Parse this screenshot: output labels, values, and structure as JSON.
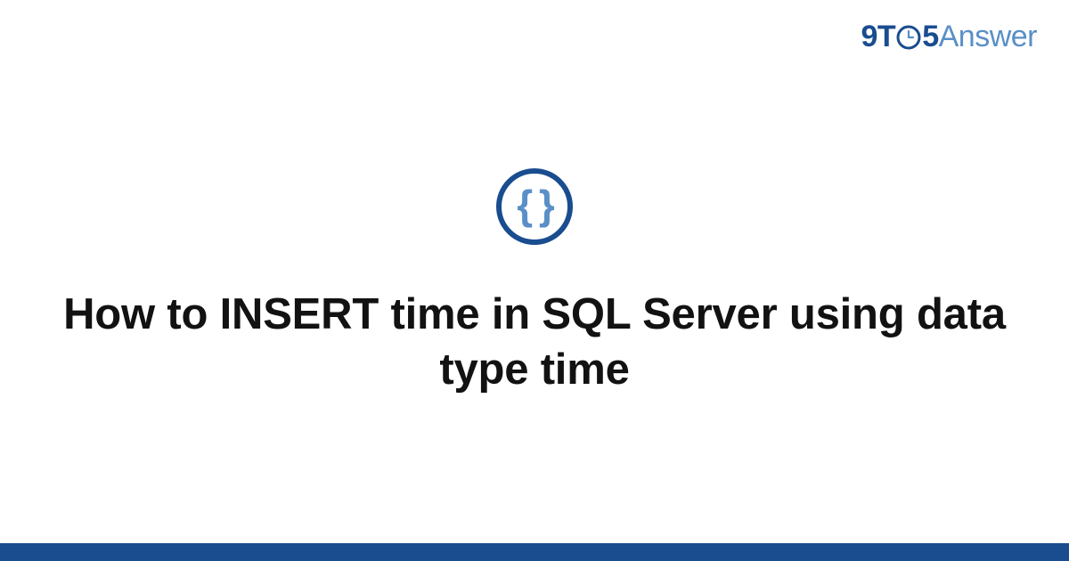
{
  "brand": {
    "part1": "9T",
    "part2": "5",
    "part3": "Answer"
  },
  "title": "How to INSERT time in SQL Server using data type time",
  "colors": {
    "primary": "#1a4d8f",
    "secondary": "#5a8fc7"
  },
  "topic_icon": "code-braces-icon"
}
